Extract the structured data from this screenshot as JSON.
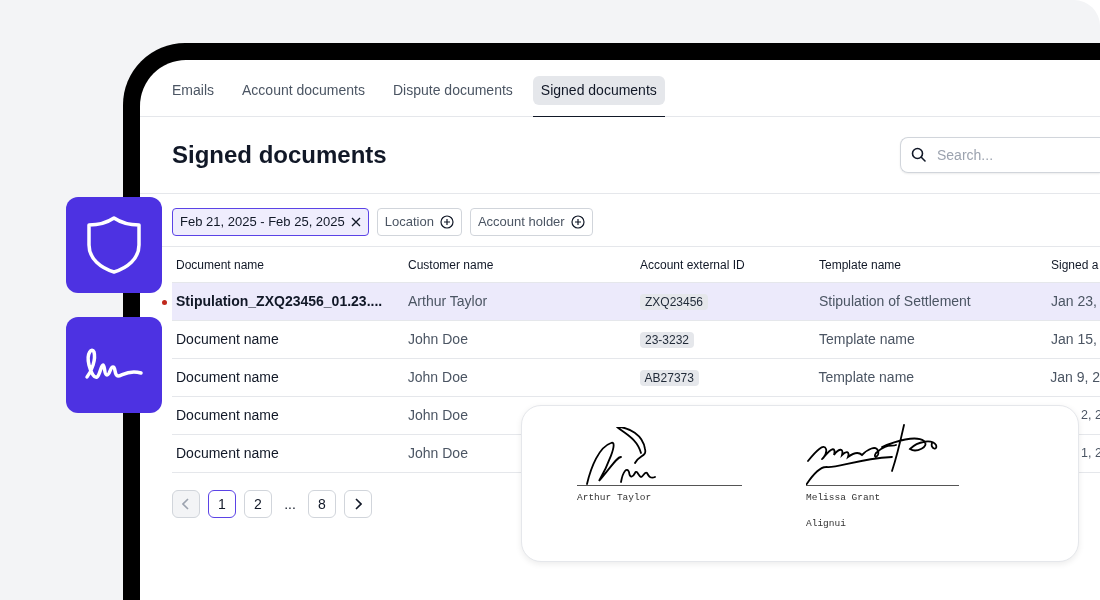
{
  "tabs": [
    {
      "label": "Emails",
      "selected": false
    },
    {
      "label": "Account documents",
      "selected": false
    },
    {
      "label": "Dispute documents",
      "selected": false
    },
    {
      "label": "Signed documents",
      "selected": true
    }
  ],
  "title": "Signed documents",
  "search": {
    "placeholder": "Search..."
  },
  "filters": [
    {
      "label": "Feb 21, 2025 - Feb 25, 2025",
      "active": true
    },
    {
      "label": "Location",
      "active": false
    },
    {
      "label": "Account holder",
      "active": false
    }
  ],
  "table": {
    "columns": [
      "Document name",
      "Customer name",
      "Account external ID",
      "Template name",
      "Signed a"
    ],
    "rows": [
      {
        "selected": true,
        "unread": true,
        "document": "Stipulation_ZXQ23456_01.23....",
        "customer": "Arthur Taylor",
        "account_id": "ZXQ23456",
        "template": "Stipulation of Settlement",
        "signed": "Jan 23,"
      },
      {
        "selected": false,
        "unread": false,
        "document": "Document name",
        "customer": "John Doe",
        "account_id": "23-3232",
        "template": "Template name",
        "signed": "Jan 15,"
      },
      {
        "selected": false,
        "unread": false,
        "document": "Document name",
        "customer": "John Doe",
        "account_id": "AB27373",
        "template": "Template name",
        "signed": "Jan 9, 2"
      },
      {
        "selected": false,
        "unread": false,
        "document": "Document name",
        "customer": "John Doe",
        "signed_tail": "2, 2"
      },
      {
        "selected": false,
        "unread": false,
        "document": "Document name",
        "customer": "John Doe",
        "signed_tail": "1, 2"
      }
    ]
  },
  "pagination": [
    {
      "kind": "prev",
      "disabled": true
    },
    {
      "kind": "page",
      "label": "1",
      "selected": true
    },
    {
      "kind": "page",
      "label": "2",
      "selected": false
    },
    {
      "kind": "gap",
      "label": "..."
    },
    {
      "kind": "page",
      "label": "8",
      "selected": false
    },
    {
      "kind": "next",
      "disabled": false
    }
  ],
  "signature_card": {
    "signers": [
      {
        "name": "Arthur Taylor"
      },
      {
        "name": "Melissa Grant",
        "company": "Alignui"
      }
    ]
  }
}
